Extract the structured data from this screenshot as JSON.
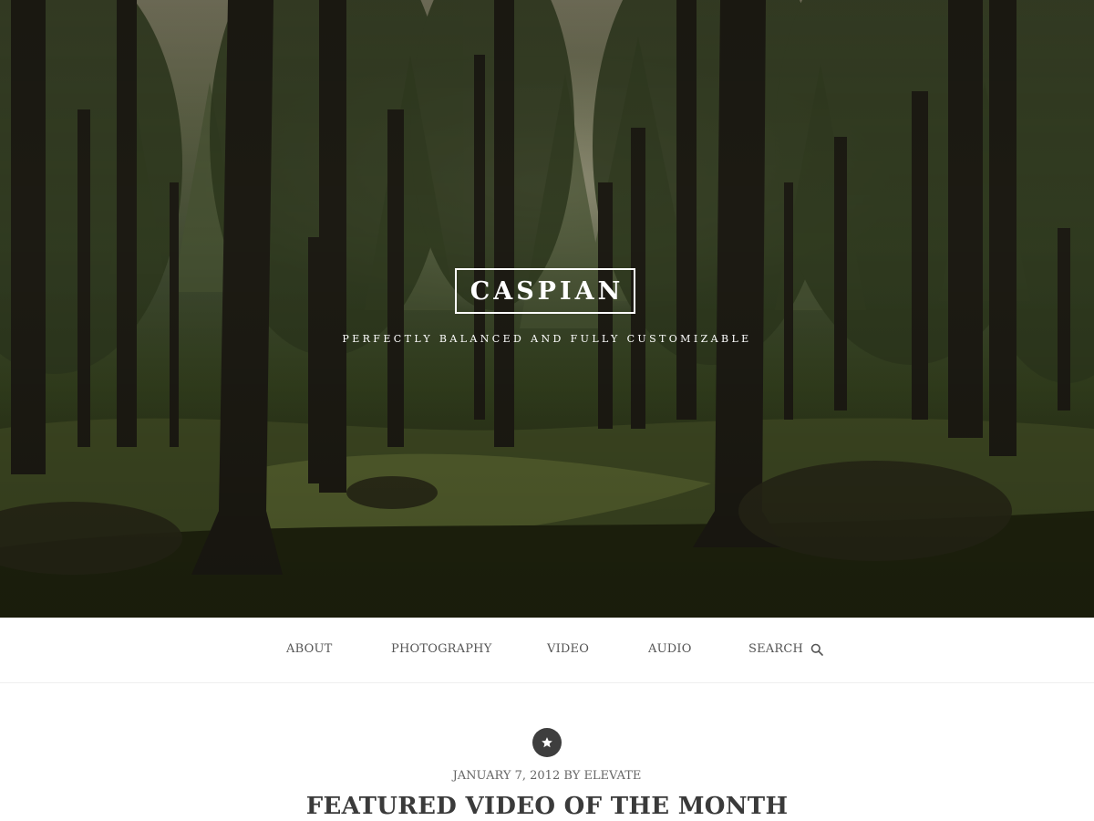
{
  "site": {
    "title": "CASPIAN",
    "tagline": "PERFECTLY BALANCED AND FULLY CUSTOMIZABLE"
  },
  "nav": {
    "items": [
      {
        "label": "ABOUT"
      },
      {
        "label": "PHOTOGRAPHY"
      },
      {
        "label": "VIDEO"
      },
      {
        "label": "AUDIO"
      }
    ],
    "search_label": "SEARCH"
  },
  "post": {
    "badge_icon": "star-icon",
    "date": "JANUARY 7, 2012",
    "by": "BY",
    "author": "ELEVATE",
    "title": "FEATURED VIDEO OF THE MONTH"
  },
  "colors": {
    "text": "#3a3a3a",
    "muted": "#666666",
    "badge": "#3e3e3e"
  }
}
